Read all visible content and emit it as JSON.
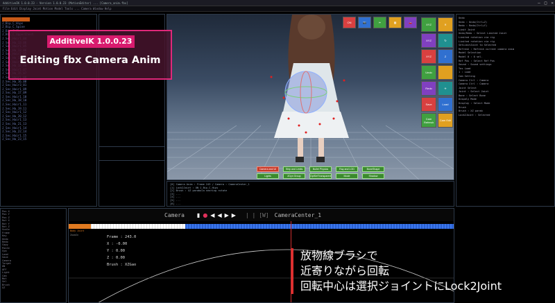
{
  "window": {
    "title": "AdditiveIK 1.0.0.23  -  Version 1.0.0.23 (MotionEditor)  ...  [Camera_anim.fbx]",
    "min": "—",
    "max": "□",
    "close": "✕"
  },
  "menubar": "File  Edit  Display  Joint  Motion  Model  Tools  ...  Camera  Window  Help",
  "badge": {
    "top": "AdditiveIK 1.0.0.23",
    "main": "Editing fbx Camera Anim"
  },
  "tree": [
    "  J_Bip_C_Hips",
    "   J_Bip_C_Spine",
    "    J_Bip_C_Chest",
    "   J_Bip_C_UpperChest",
    "  ",
    "  ",
    "  ",
    "  ",
    "  ",
    "  ",
    "  ",
    "  ",
    "  ",
    "  ",
    "  ",
    "  ",
    "  ",
    "  ",
    "    J_Sec_Hair1_04",
    "      J_Sec_Ha_13_06",
    "    J_Sec_Hair1_05",
    "      J_Sec_Ha_13_06",
    "    J_Sec_Hair1_05",
    "      J_Sec_Ha_13_06",
    "    J_Sec_Hair1_06",
    "      J_Sec_Ha_14_06",
    "    J_Sec_Hair1_07",
    "      J_Sec_Ha_15_07",
    "    J_Sec_Hair1_08",
    "      J_Sec_Ha_16_08",
    "      J_Sec_Hair3_01",
    "    J_Sec_Hair1_09",
    "      J_Sec_Ha_17_09",
    "    J_Sec_Hair1_10",
    "      J_Sec_Ha_18_10",
    "    J_Sec_Hair1_11",
    "      J_Sec_Ha_19_11",
    "    J_Sec_Hair1_12",
    "      J_Sec_Ha_20_12",
    "    J_Sec_Hair1_13",
    "      J_Sec_Ha_21_13",
    "    J_Sec_Hair1_14",
    "      J_Sec_Ha_22_14",
    "    J_Sec_Hair1_15",
    "      J_Sec_Ha_23_15"
  ],
  "viewport_buttons": [
    {
      "label": "Camera and UI",
      "style": "red"
    },
    {
      "label": "Ship and Limits",
      "style": "green"
    },
    {
      "label": "Bullet Physics",
      "style": "green"
    },
    {
      "label": "Ray and LOD",
      "style": "green"
    },
    {
      "label": "BoneShape",
      "style": "green"
    },
    {
      "label": "Lights",
      "style": "green"
    },
    {
      "label": "2Dyn Group",
      "style": "green"
    },
    {
      "label": "OptSetTransparent",
      "style": "green"
    },
    {
      "label": "Mode",
      "style": "green"
    },
    {
      "label": "Shadow",
      "style": "green"
    }
  ],
  "top_icons": [
    "ON",
    "📷",
    "✂",
    "▦",
    "🚗"
  ],
  "side_icons": [
    "XYZ",
    "✕",
    "XYZ",
    "↻",
    "XYZ",
    "Z",
    "Undo",
    "",
    "Redo",
    "✈",
    "Save",
    "Load",
    "Cam Refresh",
    "Cam Edit"
  ],
  "right_panel": [
    "Undo",
    "  Undo : Undo(Ctrl+Z)",
    "  Redo : Redo(Ctrl+Y)",
    "Limit Joint",
    "  Undo/Redo : Select Limited Joint",
    "  Limited rotation via rig",
    "  Limited rotation via rig",
    "  SetLimitJoint to Selected",
    "",
    "Refresh : Refresh current camera anim",
    "",
    "Model Selection",
    "  Model 0 : 0 sel.",
    "",
    "Ref Pos : Select Ref Pos",
    "",
    "Sound : Sound settings",
    "",
    "Tex Load",
    "  1 : Load",
    "",
    "Cam Setting",
    "  Camera Ctrl : Camera",
    "  Camera Ctrl : Camera",
    "",
    "Joint Select",
    "  Joint : Select Joint",
    "  Bone : Select Bone",
    "",
    "Dispaly Mode",
    "  Display : Select Mode",
    "",
    "Brush",
    "  Brush : XZ parab",
    "",
    "Lock2Joint : Selected"
  ],
  "console": [
    "[0] Camera Anim : Frame 243  /  Camera : CameraCenter_1",
    "[1] Lock2Joint : ON   J_Bip_C_Hips",
    "[2] Brush : XZ parabola   nearing rotate",
    "[3] ...",
    "[4] ...",
    "[5] ...",
    "[6] ..."
  ],
  "left_bottom": [
    "Pos X",
    "Pos Y",
    "Pos Z",
    "Rot X",
    "Rot Y",
    "Rot Z",
    "Scale",
    "Frame",
    "Key",
    "Undo",
    "Redo",
    "Copy",
    "Paste",
    "Sym",
    "Load",
    "Save",
    "Camera",
    "Target",
    "ON",
    "OFF",
    "Light",
    "Cam",
    "Mot",
    "Sel",
    "Brush",
    "XZ"
  ],
  "timeline": {
    "camera": "Camera",
    "separator": "| | [W]",
    "target": "CameraCenter_1",
    "side_label": "Body Joint",
    "sub_label": "ZoomIn",
    "frame_label": "Frame :",
    "frame": "243.0",
    "x_label": "X :",
    "x": "-0.00",
    "y_label": "Y :",
    "y": "0.00",
    "z_label": "Z :",
    "z": "0.00",
    "brush_label": "Brush :",
    "brush": "XZGao"
  },
  "caption": [
    "放物線ブラシで",
    "近寄りながら回転",
    "回転中心は選択ジョイントにLock2Joint"
  ]
}
